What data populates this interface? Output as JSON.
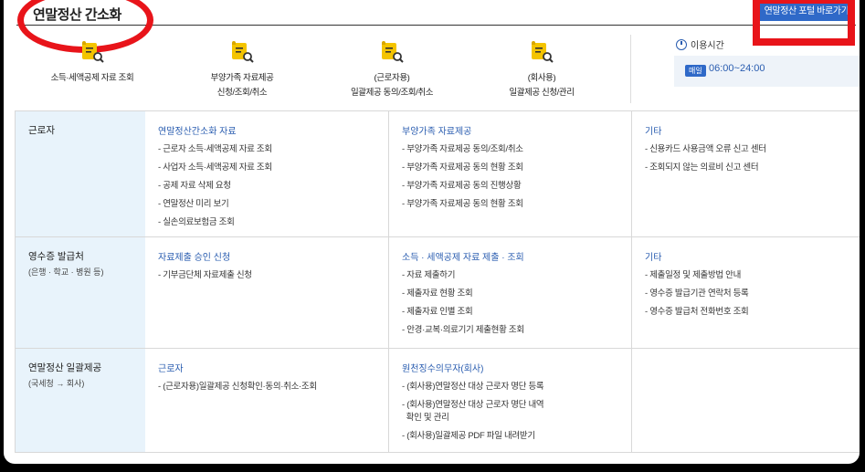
{
  "header": {
    "title": "연말정산 간소화",
    "portal_button": "연말정산 포털 바로가기"
  },
  "quick_menu": [
    {
      "icon": "document-search-icon",
      "line1": "소득·세액공제 자료 조회",
      "line2": ""
    },
    {
      "icon": "document-search-icon",
      "line1": "부양가족 자료제공",
      "line2": "신청/조회/취소"
    },
    {
      "icon": "document-search-icon",
      "line1": "(근로자용)",
      "line2": "일괄제공 동의/조회/취소"
    },
    {
      "icon": "document-search-icon",
      "line1": "(회사용)",
      "line2": "일괄제공 신청/관리"
    }
  ],
  "hours": {
    "label": "이용시간",
    "badge": "매일",
    "value": "06:00~24:00"
  },
  "rows": [
    {
      "head": "근로자",
      "sub": "",
      "cols": [
        {
          "title": "연말정산간소화 자료",
          "items": [
            "- 근로자 소득·세액공제 자료 조회",
            "- 사업자 소득·세액공제 자료 조회",
            "- 공제 자료 삭제 요청",
            "- 연말정산 미리 보기",
            "- 실손의료보험금 조회"
          ]
        },
        {
          "title": "부양가족 자료제공",
          "items": [
            "- 부양가족 자료제공 동의/조회/취소",
            "- 부양가족 자료제공 동의 현황 조회",
            "- 부양가족 자료제공 동의 진행상황",
            "- 부양가족 자료제공 동의 현황 조회"
          ]
        },
        {
          "title": "기타",
          "items": [
            "- 신용카드 사용금액 오류 신고 센터",
            "- 조회되지 않는 의료비 신고 센터"
          ]
        }
      ]
    },
    {
      "head": "영수증 발급처",
      "sub": "(은행 · 학교 · 병원 등)",
      "cols": [
        {
          "title": "자료제출 승인 신청",
          "items": [
            "- 기부금단체 자료제출 신청"
          ]
        },
        {
          "title": "소득 · 세액공제 자료 제출 · 조회",
          "items": [
            "- 자료 제출하기",
            "- 제출자료 현황 조회",
            "- 제출자료 인별 조회",
            "- 안경·교복·의료기기 제출현황 조회"
          ]
        },
        {
          "title": "기타",
          "items": [
            "- 제출일정 및 제출방법 안내",
            "- 영수증 발급기관 연락처 등록",
            "- 영수증 발급처 전화번호 조회"
          ]
        }
      ]
    },
    {
      "head": "연말정산 일괄제공",
      "sub": "(국세청 → 회사)",
      "cols": [
        {
          "title": "근로자",
          "items": [
            "- (근로자용)일괄제공 신청확인·동의·취소·조회"
          ]
        },
        {
          "title": "원천징수의무자(회사)",
          "items": [
            "- (회사용)연말정산 대상 근로자 명단 등록",
            "- (회사용)연말정산 대상 근로자 명단 내역\n  확인 및 관리",
            "- (회사용)일괄제공 PDF 파일 내려받기"
          ]
        },
        {
          "title": "",
          "items": []
        }
      ]
    }
  ],
  "colors": {
    "accent": "#2a5db0",
    "button": "#2f69c8",
    "highlight_red": "#e8141a",
    "row_header_bg": "#e8f3fb"
  }
}
